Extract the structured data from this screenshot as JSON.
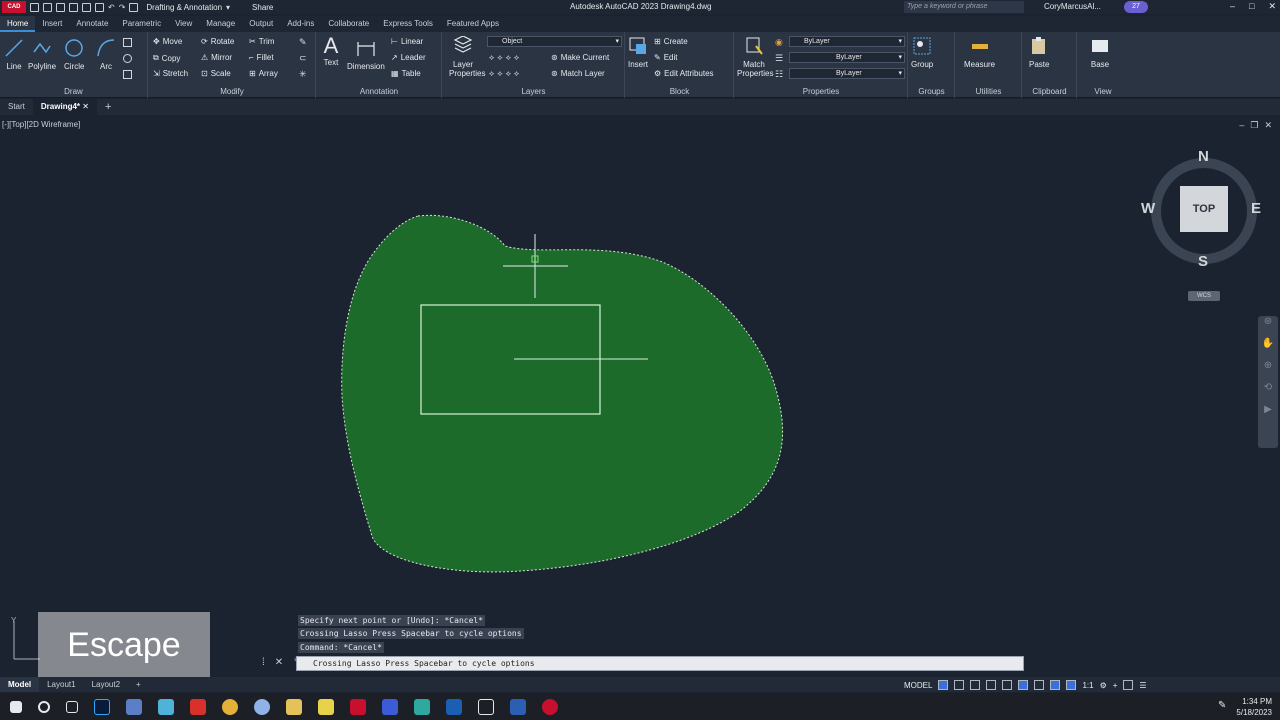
{
  "titlebar": {
    "logo": "CAD",
    "workspace": "Drafting & Annotation",
    "share": "Share",
    "app_title": "Autodesk AutoCAD 2023    Drawing4.dwg",
    "search_placeholder": "Type a keyword or phrase",
    "user": "CoryMarcusAl...",
    "badge": "27"
  },
  "tabs": [
    "Home",
    "Insert",
    "Annotate",
    "Parametric",
    "View",
    "Manage",
    "Output",
    "Add-ins",
    "Collaborate",
    "Express Tools",
    "Featured Apps"
  ],
  "draw": {
    "title": "Draw",
    "line": "Line",
    "polyline": "Polyline",
    "circle": "Circle",
    "arc": "Arc"
  },
  "modify": {
    "title": "Modify",
    "move": "Move",
    "rotate": "Rotate",
    "trim": "Trim",
    "copy": "Copy",
    "mirror": "Mirror",
    "fillet": "Fillet",
    "stretch": "Stretch",
    "scale": "Scale",
    "array": "Array"
  },
  "annotation": {
    "title": "Annotation",
    "text": "Text",
    "dimension": "Dimension",
    "linear": "Linear",
    "leader": "Leader",
    "table": "Table"
  },
  "layers": {
    "title": "Layers",
    "layer_properties": "Layer Properties",
    "current_layer": "Object",
    "make_current": "Make Current",
    "match_layer": "Match Layer"
  },
  "block": {
    "title": "Block",
    "insert": "Insert",
    "create": "Create",
    "edit": "Edit",
    "edit_attributes": "Edit Attributes"
  },
  "properties": {
    "title": "Properties",
    "match": "Match Properties",
    "color": "ByLayer",
    "lineweight": "ByLayer",
    "linetype": "ByLayer"
  },
  "groups": {
    "title": "Groups",
    "group": "Group"
  },
  "utilities": {
    "title": "Utilities",
    "measure": "Measure"
  },
  "clipboard": {
    "title": "Clipboard",
    "paste": "Paste"
  },
  "view": {
    "title": "View",
    "base": "Base"
  },
  "doctabs": [
    "Start",
    "Drawing4*"
  ],
  "viewport": {
    "label": "[-][Top][2D Wireframe]",
    "viewcube": {
      "n": "N",
      "s": "S",
      "e": "E",
      "w": "W",
      "top": "TOP",
      "wcs": "WCS"
    },
    "colors": {
      "lasso": "#1d6b2a",
      "lasso_edge": "#d8e4d8",
      "rect": "#d7f2d7"
    }
  },
  "command": {
    "history": [
      "Specify next point or [Undo]: *Cancel*",
      "Crossing Lasso  Press Spacebar to cycle options",
      "Command: *Cancel*"
    ],
    "current": "Crossing Lasso  Press Spacebar to cycle options"
  },
  "overlay": {
    "key": "Escape"
  },
  "layouttabs": [
    "Model",
    "Layout1",
    "Layout2"
  ],
  "status": {
    "model": "MODEL",
    "scale": "1:1"
  },
  "clock": {
    "time": "1:34 PM",
    "date": "5/18/2023"
  }
}
